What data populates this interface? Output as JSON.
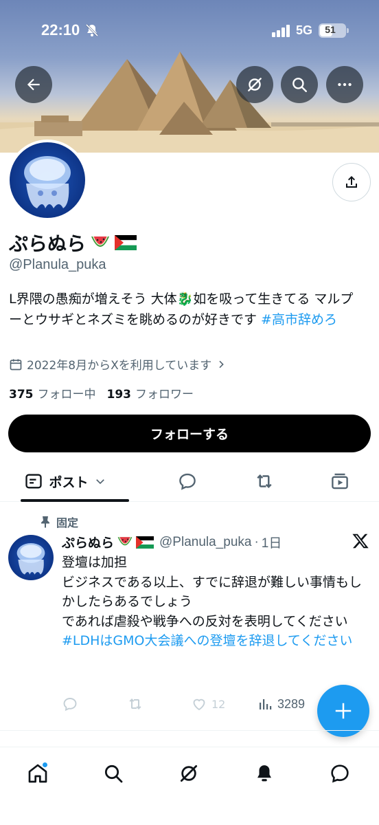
{
  "status_bar": {
    "time": "22:10",
    "network": "5G",
    "battery": "51",
    "battery_level": 0.51
  },
  "header_buttons": {
    "back": "arrow-left-icon",
    "grok": "grok-icon",
    "search": "search-icon",
    "more": "more-icon"
  },
  "profile": {
    "display_name": "ぷらぬら",
    "name_emojis": [
      "watermelon-icon",
      "palestine-flag-icon"
    ],
    "handle": "@Planula_puka",
    "bio_text": "L界隈の愚痴が増えそう 大体🐉如を吸って生きてる マルプーとウサギとネズミを眺めるのが好きです ",
    "bio_hashtag": "#高市辞めろ",
    "joined": "2022年8月からXを利用しています",
    "following_count": "375",
    "following_label": "フォロー中",
    "followers_count": "193",
    "followers_label": "フォロワー",
    "follow_button": "フォローする"
  },
  "tabs": {
    "active_label": "ポスト"
  },
  "post": {
    "pinned_label": "固定",
    "author": "ぷらぬら",
    "handle": "@Planula_puka",
    "separator": "·",
    "time": "1日",
    "text_lines": [
      "登壇は加担",
      "ビジネスである以上、すでに辞退が難しい事情もしかしたらあるでしょう",
      "であれば虐殺や戦争への反対を表明してください"
    ],
    "hashtag": "#LDHはGMO大会議への登壇を辞退してください",
    "likes": "12",
    "views": "3289"
  },
  "colors": {
    "accent": "#1d9bf0",
    "text": "#0f1419",
    "secondary": "#536471",
    "follow_button": "#000000"
  }
}
